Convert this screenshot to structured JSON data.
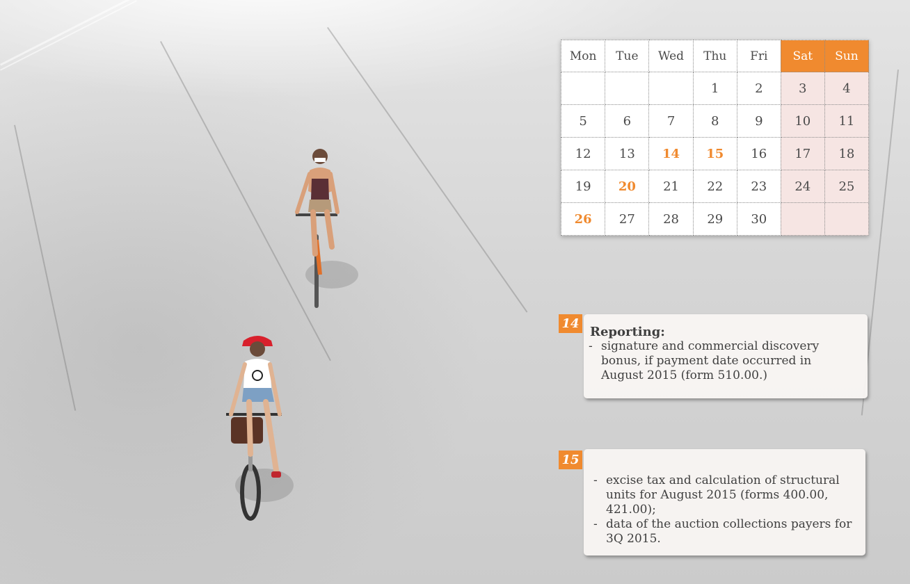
{
  "calendar": {
    "weekdays": [
      "Mon",
      "Tue",
      "Wed",
      "Thu",
      "Fri",
      "Sat",
      "Sun"
    ],
    "weeks": [
      [
        "",
        "",
        "",
        "1",
        "2",
        "3",
        "4"
      ],
      [
        "5",
        "6",
        "7",
        "8",
        "9",
        "10",
        "11"
      ],
      [
        "12",
        "13",
        "14",
        "15",
        "16",
        "17",
        "18"
      ],
      [
        "19",
        "20",
        "21",
        "22",
        "23",
        "24",
        "25"
      ],
      [
        "26",
        "27",
        "28",
        "29",
        "30",
        "",
        ""
      ]
    ],
    "highlighted_days": [
      "14",
      "15",
      "20",
      "26"
    ],
    "accent_color": "#f08a2f",
    "weekend_cell_color": "#f6e5e3"
  },
  "events": [
    {
      "day": "14",
      "title": "Reporting:",
      "items": [
        "signature and commercial discovery bonus, if payment date occurred in August 2015 (form 510.00.)"
      ]
    },
    {
      "day": "15",
      "title": "",
      "items": [
        "excise tax and calculation of structural units for August 2015 (forms 400.00, 421.00);",
        "data of the auction collections payers for 3Q 2015."
      ]
    }
  ]
}
